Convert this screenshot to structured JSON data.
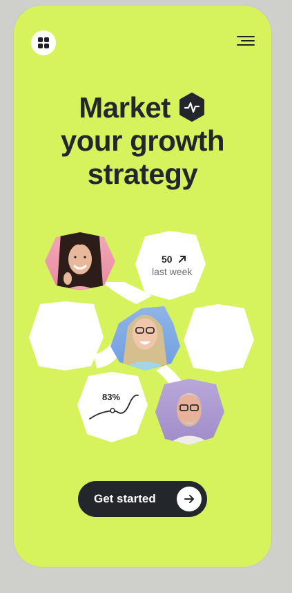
{
  "title": {
    "line1": "Market",
    "line2": "your growth",
    "line3": "strategy"
  },
  "stats": {
    "weekly_value": "50",
    "weekly_label": "last week",
    "percent": "83%"
  },
  "cta": {
    "label": "Get started"
  },
  "icons": {
    "app_grid": "grid-icon",
    "menu": "hamburger-menu-icon",
    "title_badge": "activity-pulse-icon",
    "trend": "arrow-up-right-icon",
    "cta": "arrow-right-icon"
  },
  "colors": {
    "accent": "#d6f25c",
    "dark": "#23262b",
    "card": "#ffffff"
  }
}
